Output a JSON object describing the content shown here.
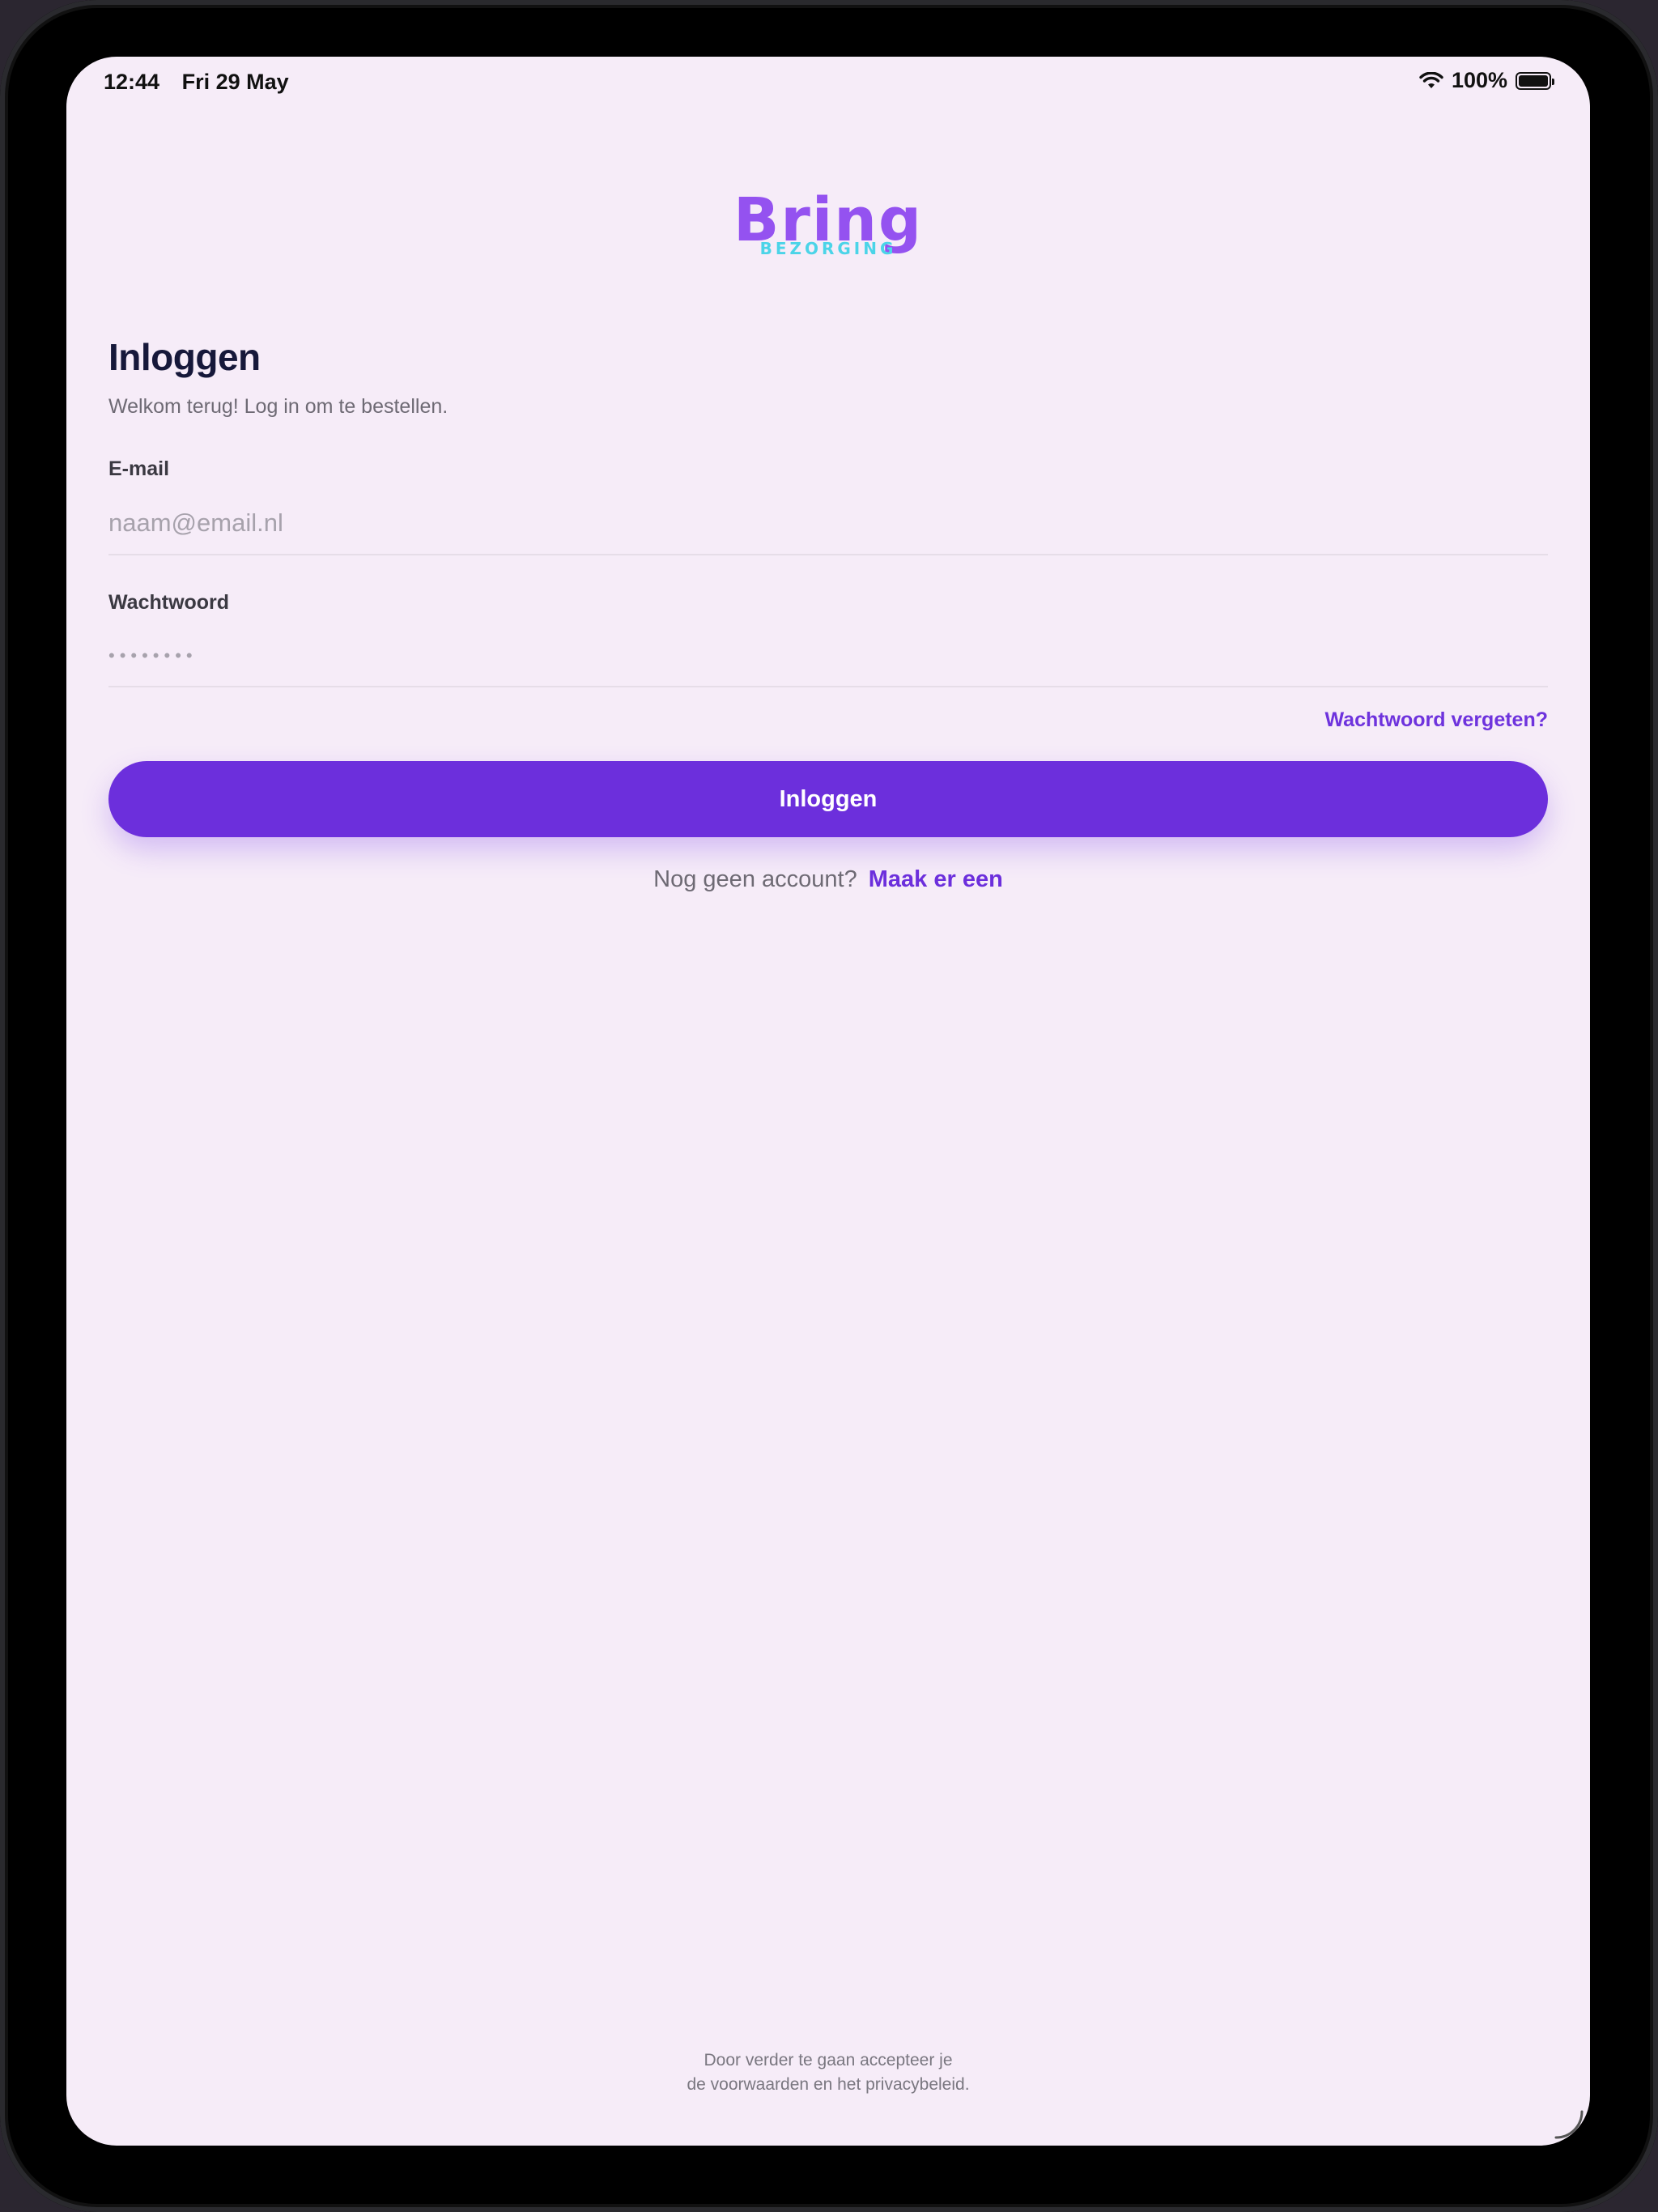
{
  "status_bar": {
    "time": "12:44",
    "date": "Fri 29 May",
    "battery_percent": "100%",
    "battery_level": 1.0,
    "wifi_icon": "wifi-icon",
    "battery_icon": "battery-icon"
  },
  "logo": {
    "main": "Bring",
    "sub": "BEZORGING",
    "main_color": "#9452f0",
    "sub_color": "#4bd4e8"
  },
  "login": {
    "title": "Inloggen",
    "subtitle": "Welkom terug! Log in om te bestellen.",
    "email_label": "E-mail",
    "email_placeholder": "naam@email.nl",
    "password_label": "Wachtwoord",
    "password_mask": "••••••••",
    "forgot_label": "Wachtwoord vergeten?",
    "button_label": "Inloggen",
    "signup_prompt": "Nog geen account?",
    "signup_link": "Maak er een"
  },
  "footer": {
    "terms_line1": "Door verder te gaan accepteer je",
    "terms_line2": "de voorwaarden en het privacybeleid."
  },
  "colors": {
    "background": "#f6ecf8",
    "accent": "#6c2fdc",
    "title": "#16183a"
  }
}
